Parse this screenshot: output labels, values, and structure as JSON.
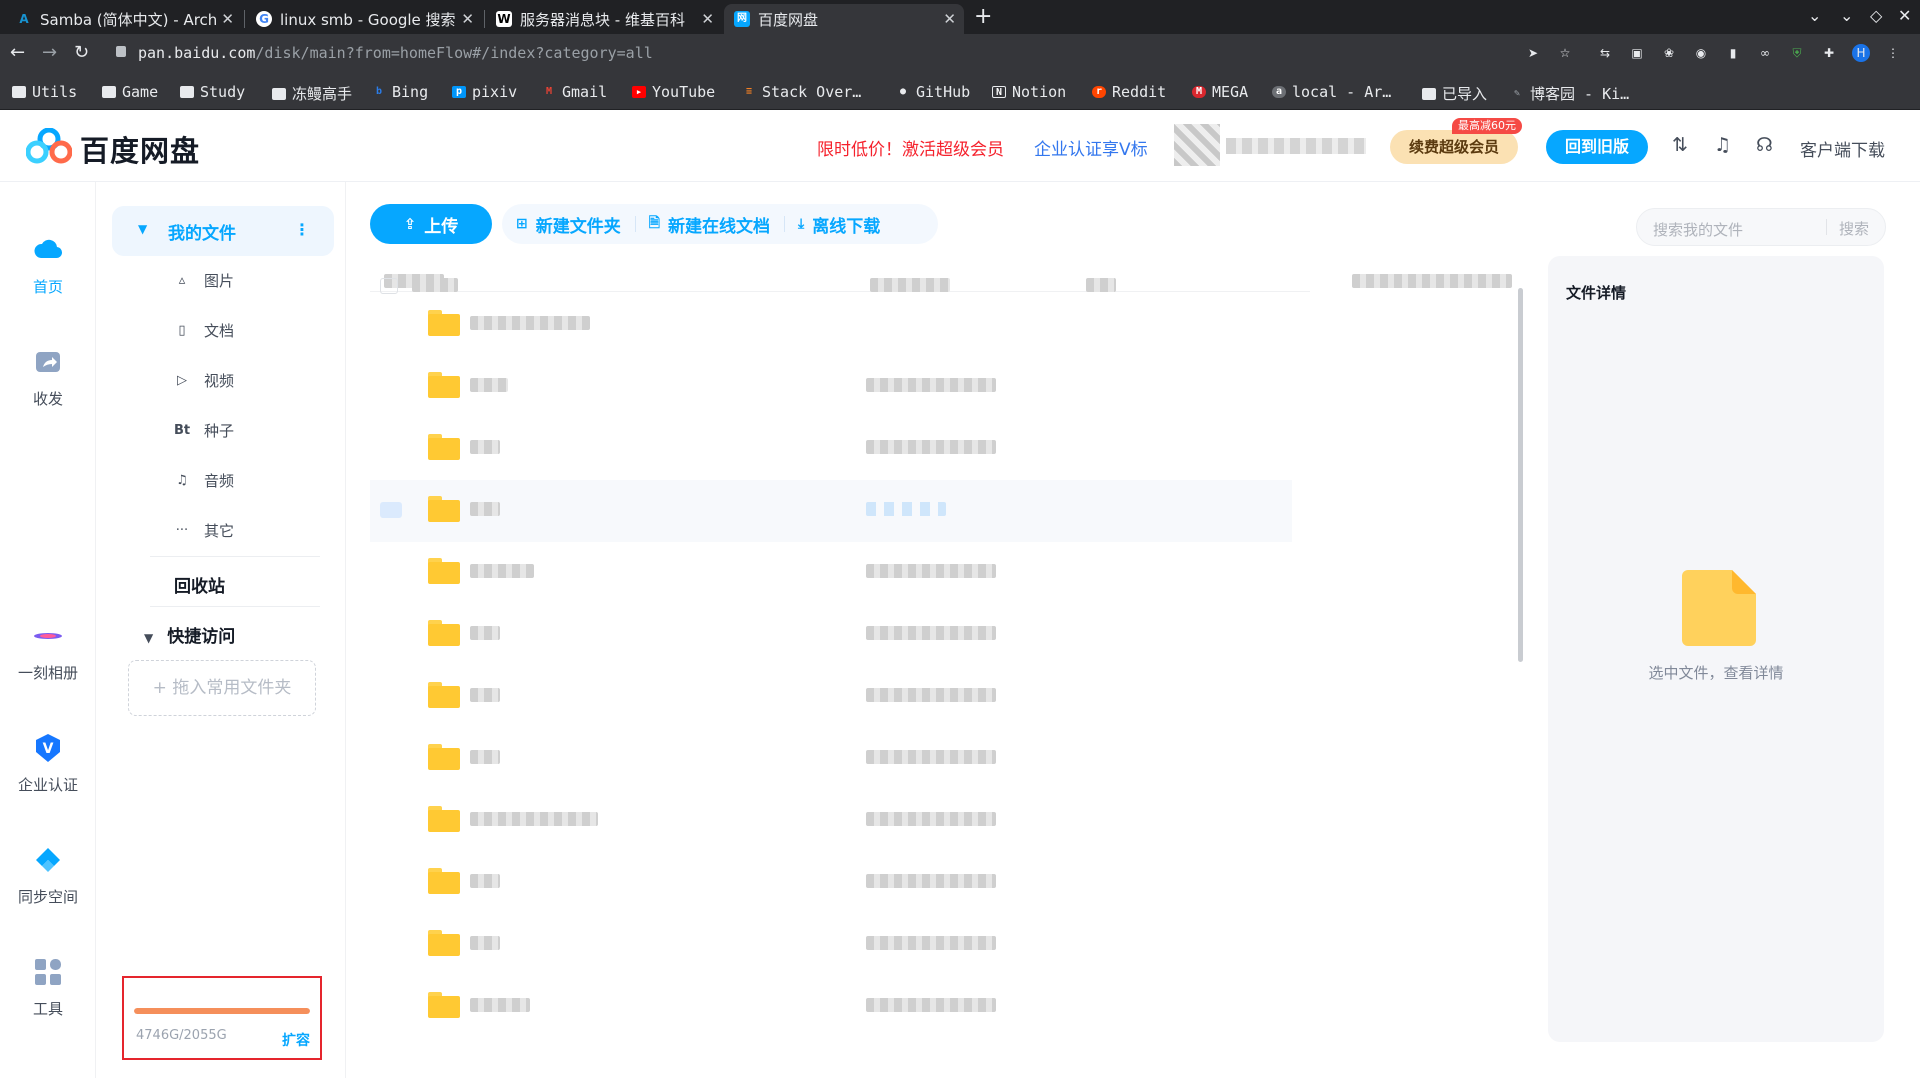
{
  "browser": {
    "tabs": [
      {
        "title": "Samba (简体中文) - ArchW",
        "icon": "A",
        "icon_color": "#1793d1"
      },
      {
        "title": "linux smb - Google 搜索",
        "icon": "G",
        "icon_color": "#4285f4"
      },
      {
        "title": "服务器消息块 - 维基百科",
        "icon": "W",
        "icon_color": "#ffffff"
      },
      {
        "title": "百度网盘",
        "icon": "网",
        "icon_color": "#06a7ff",
        "active": true
      }
    ],
    "new_tab": "+",
    "url_host": "pan.baidu.com",
    "url_path": "/disk/main?from=homeFlow#/index?category=all",
    "avatar_letter": "H",
    "bookmarks": [
      {
        "label": "Utils",
        "icon": "folder"
      },
      {
        "label": "Game",
        "icon": "folder"
      },
      {
        "label": "Study",
        "icon": "folder"
      },
      {
        "label": "冻鳗高手",
        "icon": "folder"
      },
      {
        "label": "Bing",
        "icon": "b"
      },
      {
        "label": "pixiv",
        "icon": "p"
      },
      {
        "label": "Gmail",
        "icon": "M"
      },
      {
        "label": "YouTube",
        "icon": "yt"
      },
      {
        "label": "Stack Over…",
        "icon": "so"
      },
      {
        "label": "GitHub",
        "icon": "gh"
      },
      {
        "label": "Notion",
        "icon": "N"
      },
      {
        "label": "Reddit",
        "icon": "r"
      },
      {
        "label": "MEGA",
        "icon": "M"
      },
      {
        "label": "local - Ar…",
        "icon": "a"
      },
      {
        "label": "已导入",
        "icon": "folder"
      },
      {
        "label": "博客园 - Ki…",
        "icon": "c"
      }
    ]
  },
  "header": {
    "logo_text": "百度网盘",
    "promo": "限时低价！激活超级会员",
    "cert": "企业认证享V标",
    "vip_button": "续费超级会员",
    "vip_tag": "最高减60元",
    "old_version_button": "回到旧版",
    "client_download": "客户端下载"
  },
  "leftnav": [
    {
      "label": "首页",
      "icon": "cloud-icon",
      "active": true
    },
    {
      "label": "收发",
      "icon": "share-icon"
    },
    {
      "label": "一刻相册",
      "icon": "album-icon"
    },
    {
      "label": "企业认证",
      "icon": "verify-icon"
    },
    {
      "label": "同步空间",
      "icon": "sync-icon"
    },
    {
      "label": "工具",
      "icon": "tools-icon"
    }
  ],
  "sidebar": {
    "my_files": "我的文件",
    "categories": [
      {
        "label": "图片",
        "icon": "▵"
      },
      {
        "label": "文档",
        "icon": "▯"
      },
      {
        "label": "视频",
        "icon": "▷"
      },
      {
        "label": "种子",
        "icon": "Bt"
      },
      {
        "label": "音频",
        "icon": "♫"
      },
      {
        "label": "其它",
        "icon": "···"
      }
    ],
    "recycle": "回收站",
    "quick_access": "快捷访问",
    "drop_hint": "+ 拖入常用文件夹",
    "quota_text": "4746G/2055G",
    "quota_fraction": 1.0,
    "expand": "扩容"
  },
  "toolbar": {
    "upload": "上传",
    "new_folder": "新建文件夹",
    "new_doc": "新建在线文档",
    "offline": "离线下载",
    "search_placeholder": "搜索我的文件",
    "search_button": "搜索"
  },
  "detail": {
    "title": "文件详情",
    "hint": "选中文件，查看详情"
  },
  "colors": {
    "accent": "#06a7ff",
    "promo": "#f5222d",
    "folder": "#ffc933",
    "quota_fill": "#f58f5b"
  }
}
